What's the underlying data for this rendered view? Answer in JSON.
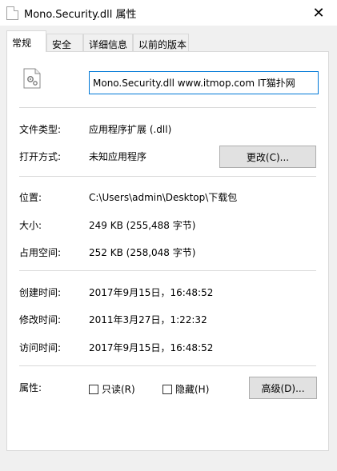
{
  "window": {
    "title": "Mono.Security.dll 属性"
  },
  "tabs": [
    "常规",
    "安全",
    "详细信息",
    "以前的版本"
  ],
  "general": {
    "filename": "Mono.Security.dll www.itmop.com IT猫扑网",
    "file_type_label": "文件类型:",
    "file_type_value": "应用程序扩展 (.dll)",
    "open_with_label": "打开方式:",
    "open_with_value": "未知应用程序",
    "change_button": "更改(C)...",
    "location_label": "位置:",
    "location_value": "C:\\Users\\admin\\Desktop\\下载包",
    "size_label": "大小:",
    "size_value": "249 KB (255,488 字节)",
    "size_on_disk_label": "占用空间:",
    "size_on_disk_value": "252 KB (258,048 字节)",
    "created_label": "创建时间:",
    "created_value": "2017年9月15日，16:48:52",
    "modified_label": "修改时间:",
    "modified_value": "2011年3月27日，1:22:32",
    "accessed_label": "访问时间:",
    "accessed_value": "2017年9月15日，16:48:52",
    "attributes_label": "属性:",
    "readonly_label": "只读(R)",
    "hidden_label": "隐藏(H)",
    "readonly_checked": false,
    "hidden_checked": false,
    "advanced_button": "高级(D)..."
  }
}
